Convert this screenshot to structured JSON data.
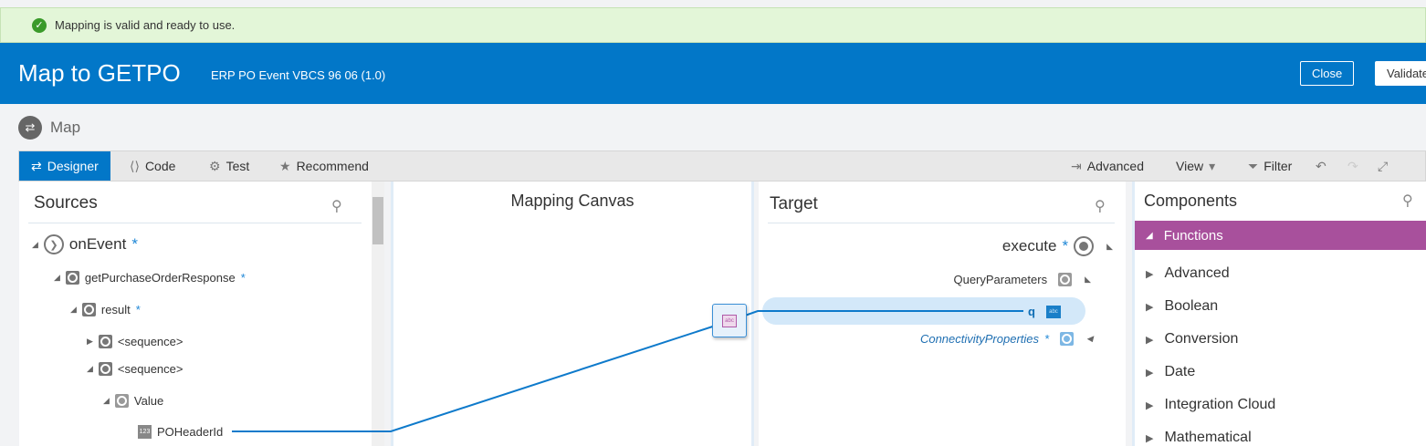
{
  "banner": {
    "message": "Mapping is valid and ready to use.",
    "icon": "check-circle-icon"
  },
  "header": {
    "title": "Map to GETPO",
    "subtitle": "ERP PO Event VBCS 96 06 (1.0)",
    "close": "Close",
    "validate": "Validate"
  },
  "breadcrumb": {
    "label": "Map"
  },
  "tabs": [
    {
      "label": "Designer",
      "active": true
    },
    {
      "label": "Code"
    },
    {
      "label": "Test"
    },
    {
      "label": "Recommend"
    }
  ],
  "toolbar_right": {
    "advanced": "Advanced",
    "view": "View",
    "filter": "Filter"
  },
  "sources": {
    "title": "Sources",
    "nodes": [
      "onEvent",
      "getPurchaseOrderResponse",
      "result",
      "<sequence>",
      "<sequence>",
      "Value",
      "POHeaderId"
    ],
    "star": "*"
  },
  "canvas": {
    "title": "Mapping Canvas"
  },
  "target": {
    "title": "Target",
    "nodes": [
      "execute",
      "QueryParameters",
      "q",
      "ConnectivityProperties"
    ],
    "star": "*",
    "abc": "abc"
  },
  "components": {
    "title": "Components",
    "section": "Functions",
    "items": [
      "Advanced",
      "Boolean",
      "Conversion",
      "Date",
      "Integration Cloud",
      "Mathematical"
    ]
  },
  "colors": {
    "accent": "#0277c8",
    "functions": "#a8509c",
    "banner": "#e3f6d8"
  }
}
